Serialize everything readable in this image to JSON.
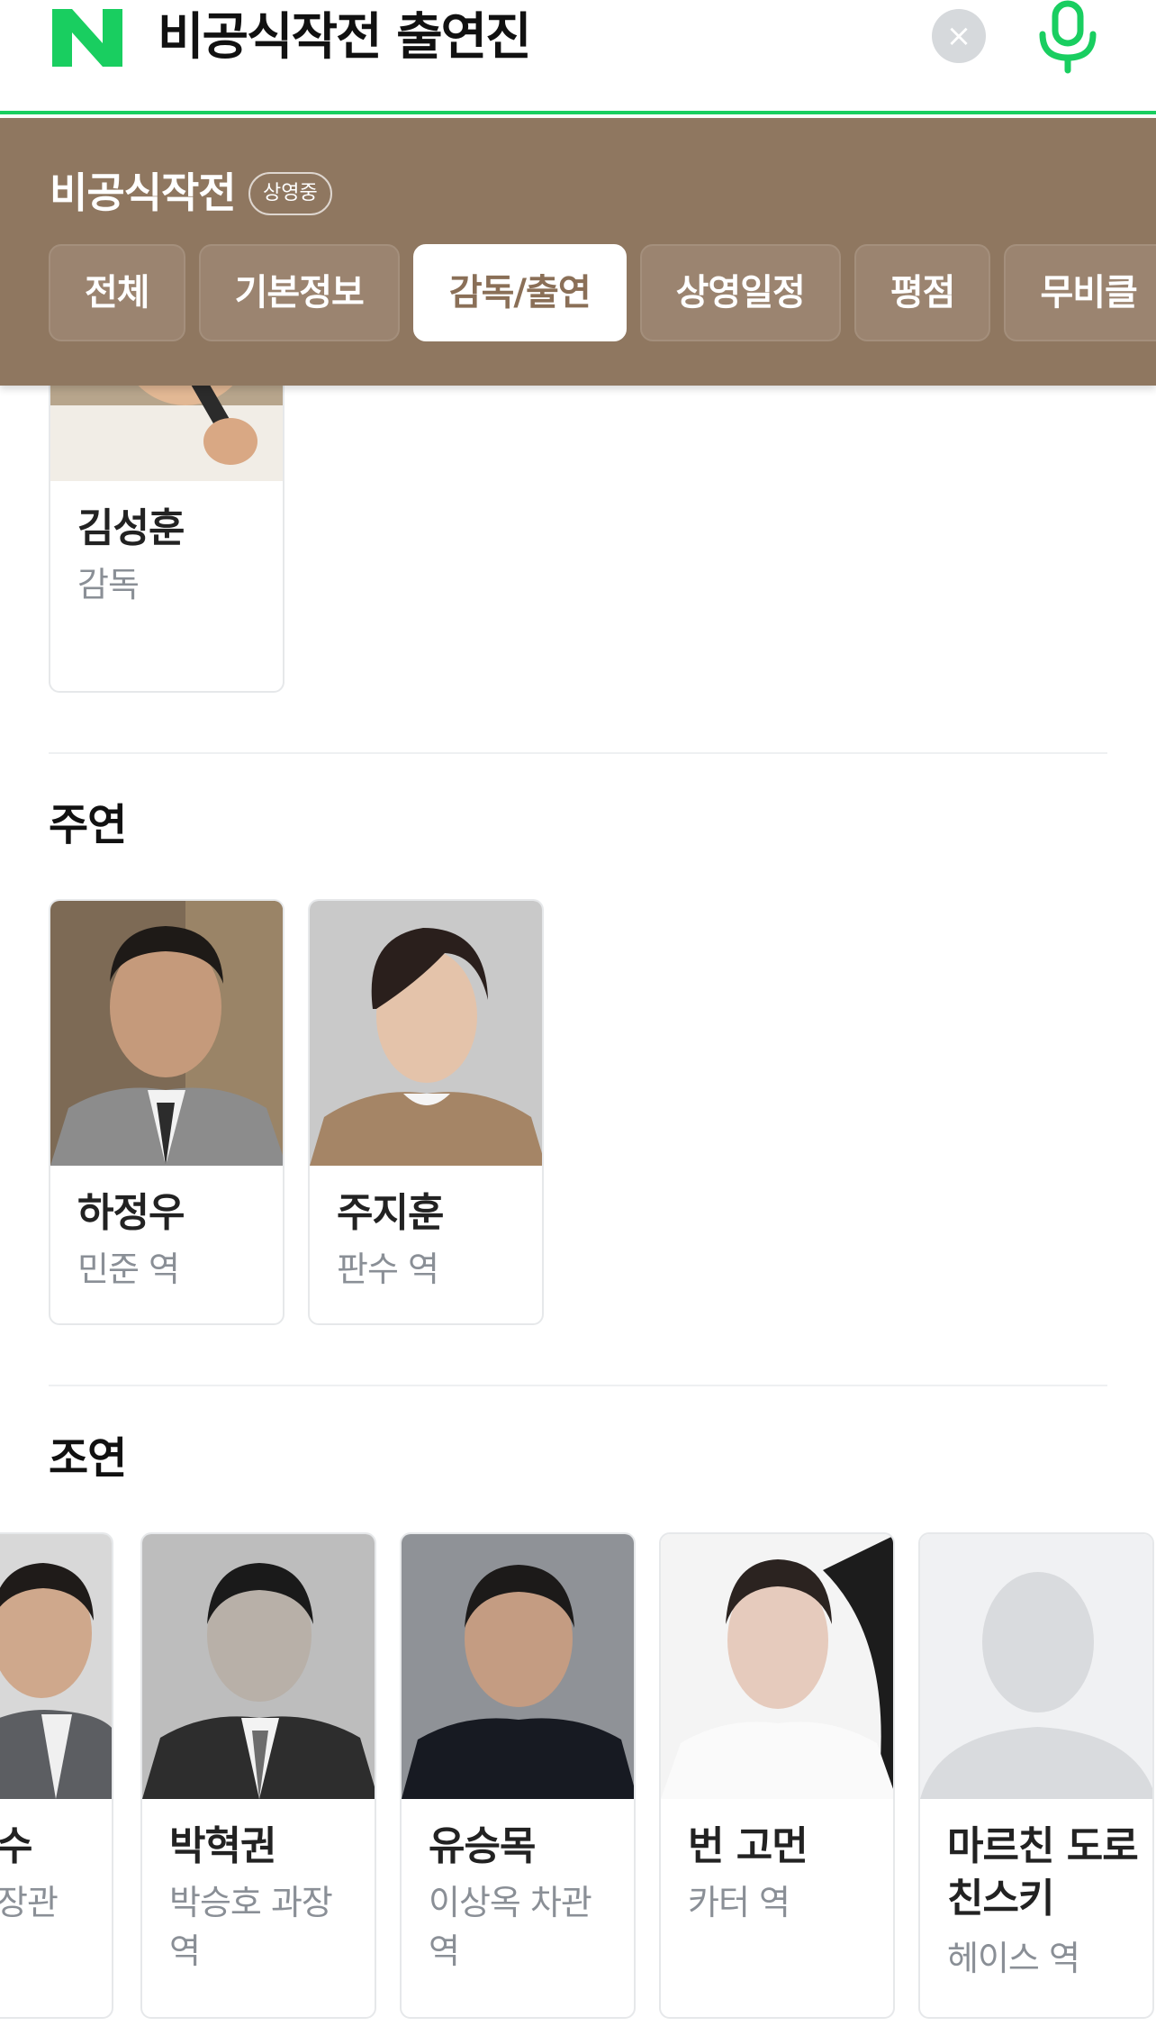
{
  "search": {
    "logo_letter": "N",
    "query": "비공식작전 출연진",
    "clear_label": "×",
    "brand_color": "#19ce60"
  },
  "movie": {
    "title": "비공식작전",
    "status": "상영중",
    "header_color": "#8f7760",
    "tabs": [
      {
        "label": "전체"
      },
      {
        "label": "기본정보"
      },
      {
        "label": "감독/출연"
      },
      {
        "label": "상영일정"
      },
      {
        "label": "평점"
      },
      {
        "label": "무비클"
      }
    ],
    "active_tab": "감독/출연"
  },
  "director": {
    "name": "김성훈",
    "role": "감독"
  },
  "lead": {
    "title": "주연",
    "people": [
      {
        "name": "하정우",
        "role": "민준 역"
      },
      {
        "name": "주지훈",
        "role": "판수 역"
      }
    ]
  },
  "supporting": {
    "title": "조연",
    "people": [
      {
        "name": "수",
        "role": "장관"
      },
      {
        "name": "박혁권",
        "role": "박승호 과장 역"
      },
      {
        "name": "유승목",
        "role": "이상옥 차관 역"
      },
      {
        "name": "번 고먼",
        "role": "카터 역"
      },
      {
        "name": "마르친 도로친스키",
        "role": "헤이스 역"
      }
    ]
  }
}
